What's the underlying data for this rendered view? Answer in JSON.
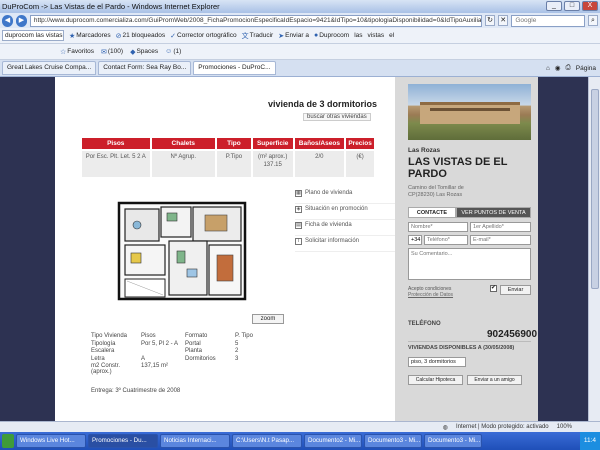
{
  "window": {
    "title": "DuProCom -> Las Vistas de el Pardo - Windows Internet Explorer",
    "minimize": "_",
    "maximize": "□",
    "close": "X"
  },
  "address_bar": {
    "url": "http://www.duprocom.comercializa.com/GuiPromWeb/2008_FichaPromocionEspecificaIdEspacio=9421&IdTipo=10&tipologiaDisponibilidad=0&IdTipoAuxiliada",
    "search_placeholder": "Google"
  },
  "toolbar1": {
    "search_value": "duprocom las vistas el p",
    "items": [
      "Marcadores",
      "21 bloqueados",
      "Corrector ortográfico",
      "Traducir",
      "Enviar a",
      "Duprocom",
      "las",
      "vistas",
      "el"
    ]
  },
  "toolbar2": {
    "items": [
      "Favoritos",
      "(100)",
      "Spaces",
      "(1)"
    ]
  },
  "tabs": [
    {
      "label": "Great Lakes Cruise Compa..."
    },
    {
      "label": "Contact Form: Sea Ray Bo..."
    },
    {
      "label": "Promociones - DuProC..."
    }
  ],
  "tabs_right": {
    "page": "Página"
  },
  "main": {
    "heading": "vivienda de 3 dormitorios",
    "search_link": "buscar otras viviendas",
    "grid_headers": [
      "Pisos",
      "Chalets",
      "Tipo",
      "Superficie",
      "Baños/Aseos",
      "Precios"
    ],
    "grid_sub": [
      "Por Esc. Plt. Let. 5 2 A",
      "Nº Agrup.",
      "P.Tipo",
      "(m² aprox.) 137.15",
      "2/0",
      "(€)"
    ],
    "zoom_label": "zoom",
    "side_links": [
      "Plano de vivienda",
      "Situación en promoción",
      "Ficha de vivienda",
      "Solicitar información"
    ],
    "specs": [
      [
        "Tipo Vivienda",
        "Pisos",
        "Formato",
        "P. Tipo"
      ],
      [
        "Tipología",
        "Por 5, Pl 2 - A",
        "Portal",
        "5"
      ],
      [
        "Escalera",
        "",
        "Planta",
        "2"
      ],
      [
        "Letra",
        "A",
        "Dormitorios",
        "3"
      ],
      [
        "m2 Constr. (aprox.)",
        "137,15 m²",
        "",
        ""
      ]
    ],
    "delivery": "Entrega: 3º Cuatrimestre de 2008"
  },
  "right_panel": {
    "region": "Las Rozas",
    "name": "LAS VISTAS DE EL PARDO",
    "info_line1": "Camino del Tomillar de",
    "info_line2": "CP(28230) Las Rozas",
    "tab_contact": "CONTACTE",
    "tab_points": "VER PUNTOS DE VENTA",
    "name_placeholder": "Nombre*",
    "surname_placeholder": "1er Apellido*",
    "phone_prefix": "+34",
    "phone_placeholder": "Teléfono*",
    "email_placeholder": "E-mail*",
    "comment_placeholder": "Su Comentario...",
    "accept_text": "Acepto condiciones",
    "privacy_link": "Protección de Datos",
    "check": "✔",
    "send": "Enviar",
    "phone_label": "TELÉFONO",
    "phone_number": "902456900",
    "avail": "VIVIENDAS DISPONIBLES A (30/05/2008)",
    "select_value": "piso, 3 dormitorios",
    "btn_calc": "Calcular Hipoteca",
    "btn_email": "Enviar a un amigo"
  },
  "statusbar": {
    "zone": "Internet | Modo protegido: activado",
    "zoom": "100%"
  },
  "taskbar": {
    "items": [
      "Windows Live Hot...",
      "Promociones - Du...",
      "Noticias Internaci...",
      "C:\\Users\\N.t Pasap...",
      "Documento2 - Mi...",
      "Documento3 - Mi...",
      "Documento3 - Mi..."
    ],
    "tray": "11:4"
  }
}
